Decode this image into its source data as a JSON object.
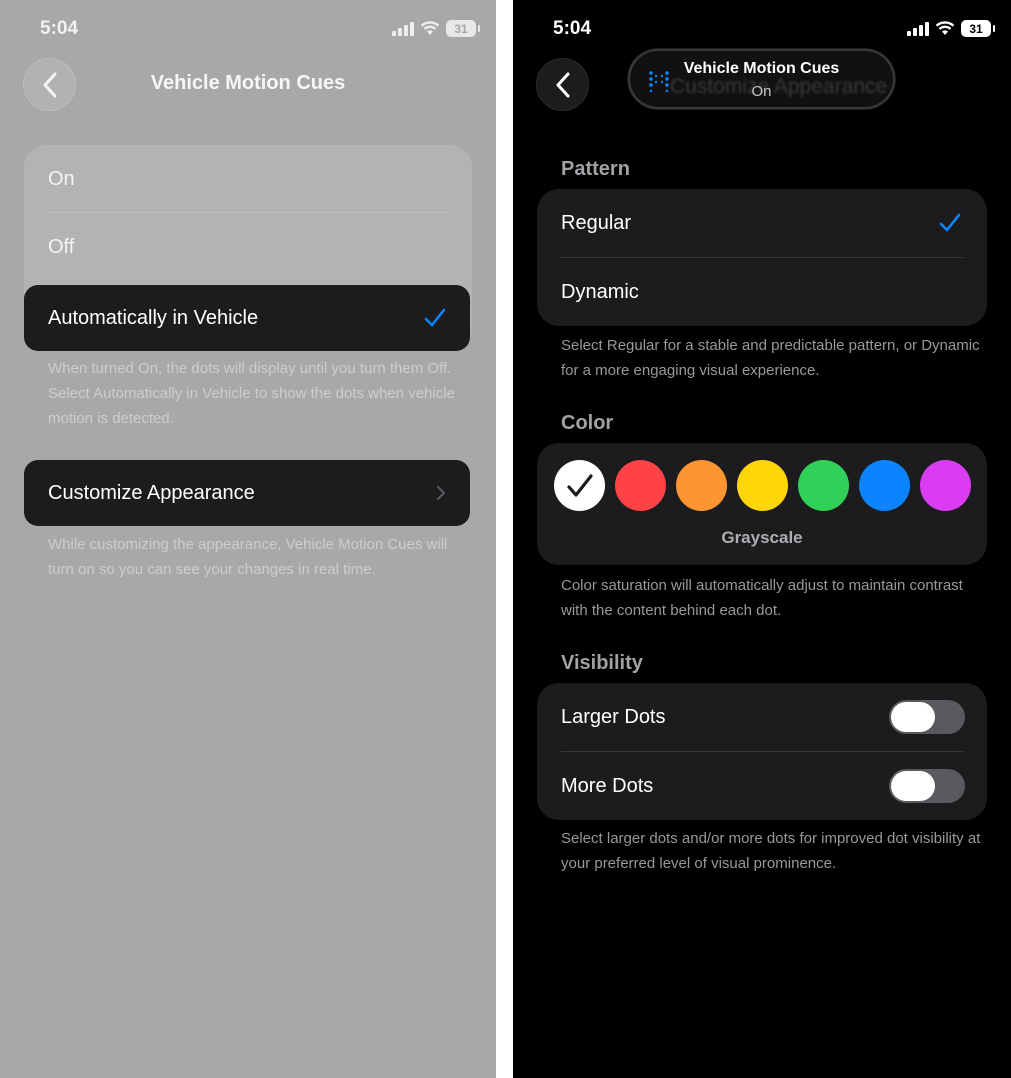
{
  "colors": {
    "accent": "#0a84ff"
  },
  "left": {
    "status_time": "5:04",
    "battery": "31",
    "nav_title": "Vehicle Motion Cues",
    "mode_options": [
      {
        "label": "On",
        "selected": false
      },
      {
        "label": "Off",
        "selected": false
      },
      {
        "label": "Automatically in Vehicle",
        "selected": true
      }
    ],
    "mode_footnote": "When turned On, the dots will display until you turn them Off. Select Automatically in Vehicle to show the dots when vehicle motion is detected.",
    "customize_label": "Customize Appearance",
    "customize_footnote": "While customizing the appearance, Vehicle Motion Cues will turn on so you can see your changes in real time."
  },
  "right": {
    "status_time": "5:04",
    "battery": "31",
    "banner": {
      "title": "Vehicle Motion Cues",
      "subtitle": "On",
      "ghost_title": "Customize Appearance"
    },
    "pattern": {
      "header": "Pattern",
      "options": [
        {
          "label": "Regular",
          "selected": true
        },
        {
          "label": "Dynamic",
          "selected": false
        }
      ],
      "footnote": "Select Regular for a stable and predictable pattern, or Dynamic for a more engaging visual experience."
    },
    "color": {
      "header": "Color",
      "swatches": [
        {
          "name": "grayscale",
          "hex": "#ffffff",
          "selected": true
        },
        {
          "name": "red",
          "hex": "#fe4245",
          "selected": false
        },
        {
          "name": "orange",
          "hex": "#fe9533",
          "selected": false
        },
        {
          "name": "yellow",
          "hex": "#ffd60a",
          "selected": false
        },
        {
          "name": "green",
          "hex": "#30d158",
          "selected": false
        },
        {
          "name": "blue",
          "hex": "#0a84ff",
          "selected": false
        },
        {
          "name": "purple",
          "hex": "#da3cf2",
          "selected": false
        }
      ],
      "selected_label": "Grayscale",
      "footnote": "Color saturation will automatically adjust to maintain contrast with the content behind each dot."
    },
    "visibility": {
      "header": "Visibility",
      "toggles": [
        {
          "label": "Larger Dots",
          "on": false
        },
        {
          "label": "More Dots",
          "on": false
        }
      ],
      "footnote": "Select larger dots and/or more dots for improved dot visibility at your preferred level of visual prominence."
    }
  }
}
